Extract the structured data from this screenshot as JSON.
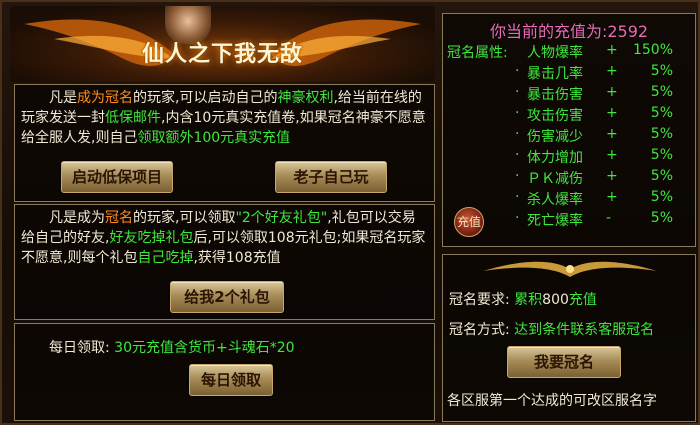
{
  "hero": {
    "title": "仙人之下我无敌"
  },
  "panel1": {
    "segments": [
      {
        "text": "凡是",
        "color": "white"
      },
      {
        "text": "成为冠名",
        "color": "orange"
      },
      {
        "text": "的玩家,可以启动自己的",
        "color": "white"
      },
      {
        "text": "神豪权利",
        "color": "green"
      },
      {
        "text": ",给当前在线的玩家发送一封",
        "color": "white"
      },
      {
        "text": "低保邮件",
        "color": "green"
      },
      {
        "text": ",内含10元真实充值卷,如果冠名神豪不愿意给全服人发,则自己",
        "color": "white"
      },
      {
        "text": "领取额外100元真实充值",
        "color": "green"
      }
    ],
    "button_left": "启动低保项目",
    "button_right": "老子自己玩"
  },
  "panel2": {
    "segments": [
      {
        "text": "凡是成为",
        "color": "white"
      },
      {
        "text": "冠名",
        "color": "orange"
      },
      {
        "text": "的玩家,可以领取",
        "color": "white"
      },
      {
        "text": "\"2个好友礼包\"",
        "color": "green"
      },
      {
        "text": ",礼包可以交易给自己的好友,",
        "color": "white"
      },
      {
        "text": "好友吃掉礼包",
        "color": "green"
      },
      {
        "text": "后,可以领取108元礼包;如果冠名玩家不愿意,则每个礼包",
        "color": "white"
      },
      {
        "text": "自己吃掉",
        "color": "green"
      },
      {
        "text": ",获得108充值",
        "color": "white"
      }
    ],
    "button": "给我2个礼包"
  },
  "panel3": {
    "label": "每日领取:",
    "reward": "30元充值含货币+斗魂石*20",
    "button": "每日领取"
  },
  "recharge": {
    "label": "你当前的充值为:",
    "value": "2592",
    "attr_label": "冠名属性:",
    "coin_label": "充值",
    "attributes": [
      {
        "name": "人物爆率",
        "sign": "+",
        "value": "150%"
      },
      {
        "name": "暴击几率",
        "sign": "+",
        "value": "5%"
      },
      {
        "name": "暴击伤害",
        "sign": "+",
        "value": "5%"
      },
      {
        "name": "攻击伤害",
        "sign": "+",
        "value": "5%"
      },
      {
        "name": "伤害减少",
        "sign": "+",
        "value": "5%"
      },
      {
        "name": "体力增加",
        "sign": "+",
        "value": "5%"
      },
      {
        "name": "ＰＫ减伤",
        "sign": "+",
        "value": "5%"
      },
      {
        "name": "杀人爆率",
        "sign": "+",
        "value": "5%"
      },
      {
        "name": "死亡爆率",
        "sign": "-",
        "value": "5%"
      }
    ]
  },
  "naming": {
    "req_label": "冠名要求:",
    "req_prefix": "累积",
    "req_amount": "800",
    "req_suffix": "充值",
    "method_label": "冠名方式:",
    "method_value": "达到条件联系客服冠名",
    "button": "我要冠名",
    "footer": "各区服第一个达成的可改区服名字"
  },
  "colors": {
    "orange": "#ff8c1a",
    "green": "#3ee63e",
    "pink": "#e86ab8",
    "white": "#f0e8d4"
  }
}
